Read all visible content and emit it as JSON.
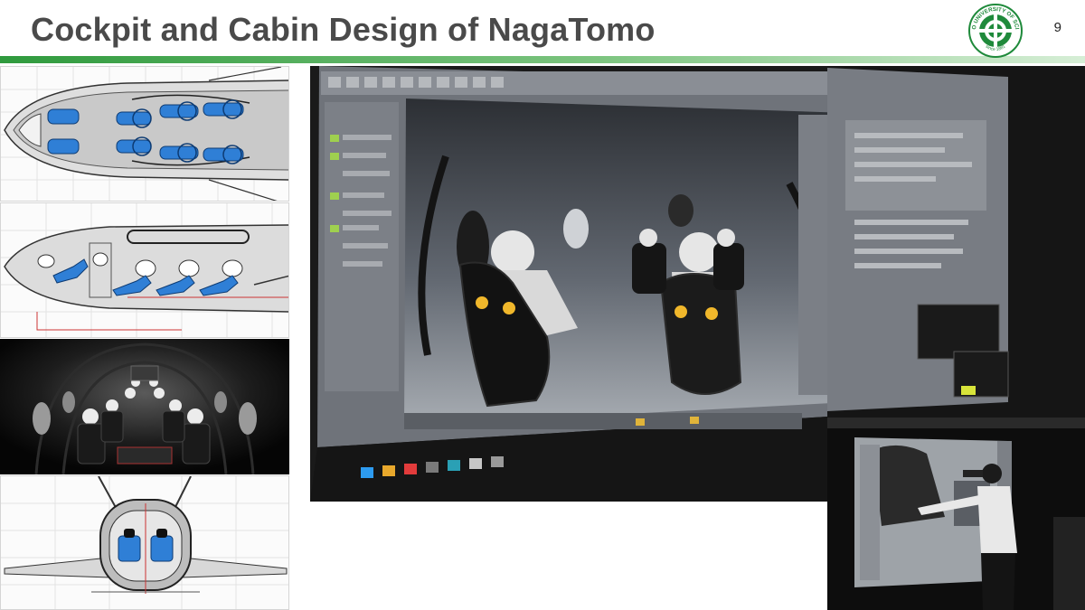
{
  "slide": {
    "title": "Cockpit and Cabin Design of NagaTomo",
    "page_number": "9"
  },
  "logo": {
    "icon": "university-seal-icon",
    "arc_top": "TOKYO UNIVERSITY OF SCIENCE",
    "arc_bottom": "since 1881",
    "color": "#1f8a3b"
  },
  "figures": {
    "cad_top_view": {
      "icon": "cabin-top-view-drawing"
    },
    "cad_side_view": {
      "icon": "cabin-side-view-drawing"
    },
    "render_interior": {
      "icon": "cabin-interior-render"
    },
    "cad_front_view": {
      "icon": "cabin-front-view-drawing"
    },
    "vr_session_photo": {
      "icon": "vr-design-session-photo"
    },
    "presenter_inset": {
      "icon": "presenter-with-vr-headset-photo"
    }
  },
  "colors": {
    "title_text": "#4a4a4a",
    "title_rule": "#2f9a3d",
    "seat_blue": "#2f7fd6"
  }
}
